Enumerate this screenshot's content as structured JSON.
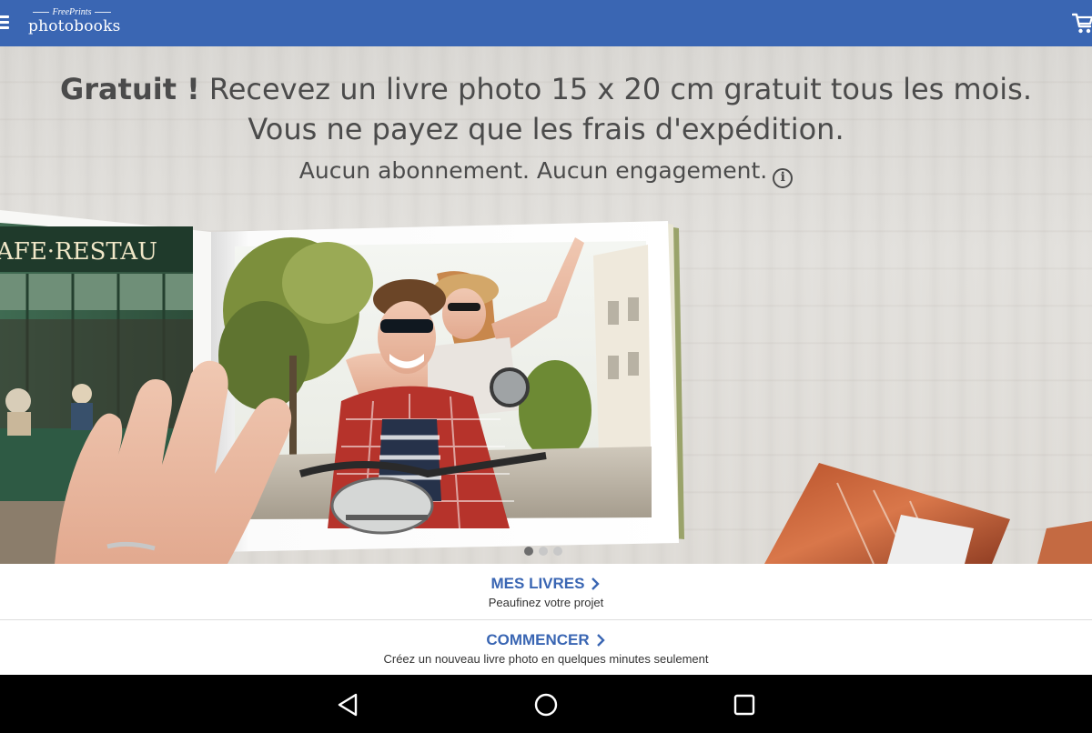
{
  "header": {
    "logo_top": "FreePrints",
    "logo_main": "photobooks",
    "menu_icon": "hamburger-menu-icon",
    "cart_icon": "shopping-cart-icon"
  },
  "hero": {
    "title_bold": "Gratuit !",
    "title_rest": " Recevez un livre photo 15 x 20 cm gratuit tous les mois.",
    "line2": "Vous ne payez que les frais d'expédition.",
    "line3": "Aucun abonnement. Aucun engagement.",
    "info_glyph": "i",
    "image_sign": "AFE·RESTAU",
    "carousel": {
      "count": 3,
      "active": 0
    }
  },
  "actions": [
    {
      "title": "MES LIVRES",
      "subtitle": "Peaufinez votre projet"
    },
    {
      "title": "COMMENCER",
      "subtitle": "Créez un nouveau livre photo en quelques minutes seulement"
    }
  ],
  "navbar": {
    "back_icon": "back-triangle-icon",
    "home_icon": "home-circle-icon",
    "recents_icon": "recents-square-icon"
  },
  "colors": {
    "brand_blue": "#3a66b3",
    "hero_text": "#4b4b4b",
    "navbar": "#000000"
  }
}
